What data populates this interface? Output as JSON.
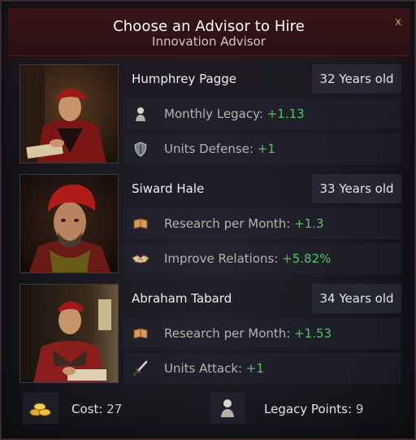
{
  "header": {
    "title": "Choose an Advisor to Hire",
    "subtitle": "Innovation Advisor",
    "close_label": "x"
  },
  "advisors": [
    {
      "name": "Humphrey Pagge",
      "age": "32 Years old",
      "stats": [
        {
          "icon": "bust-icon",
          "label": "Monthly Legacy: ",
          "value": "+1.13"
        },
        {
          "icon": "shield-icon",
          "label": "Units Defense: ",
          "value": "+1"
        }
      ]
    },
    {
      "name": "Siward Hale",
      "age": "33 Years old",
      "stats": [
        {
          "icon": "book-icon",
          "label": "Research per Month: ",
          "value": "+1.3"
        },
        {
          "icon": "handshake-icon",
          "label": "Improve Relations: ",
          "value": "+5.82%"
        }
      ]
    },
    {
      "name": "Abraham Tabard",
      "age": "34 Years old",
      "stats": [
        {
          "icon": "book-icon",
          "label": "Research per Month: ",
          "value": "+1.53"
        },
        {
          "icon": "sword-icon",
          "label": "Units Attack: ",
          "value": "+1"
        }
      ]
    }
  ],
  "footer": {
    "cost_label": "Cost: ",
    "cost_value": "27",
    "cost_icon": "gold-coins-icon",
    "legacy_label": "Legacy Points: ",
    "legacy_value": "9",
    "legacy_icon": "bust-icon"
  },
  "colors": {
    "header_bg": "#3a1518",
    "positive_value": "#5cc06a",
    "gold_accent": "#c8a050"
  }
}
